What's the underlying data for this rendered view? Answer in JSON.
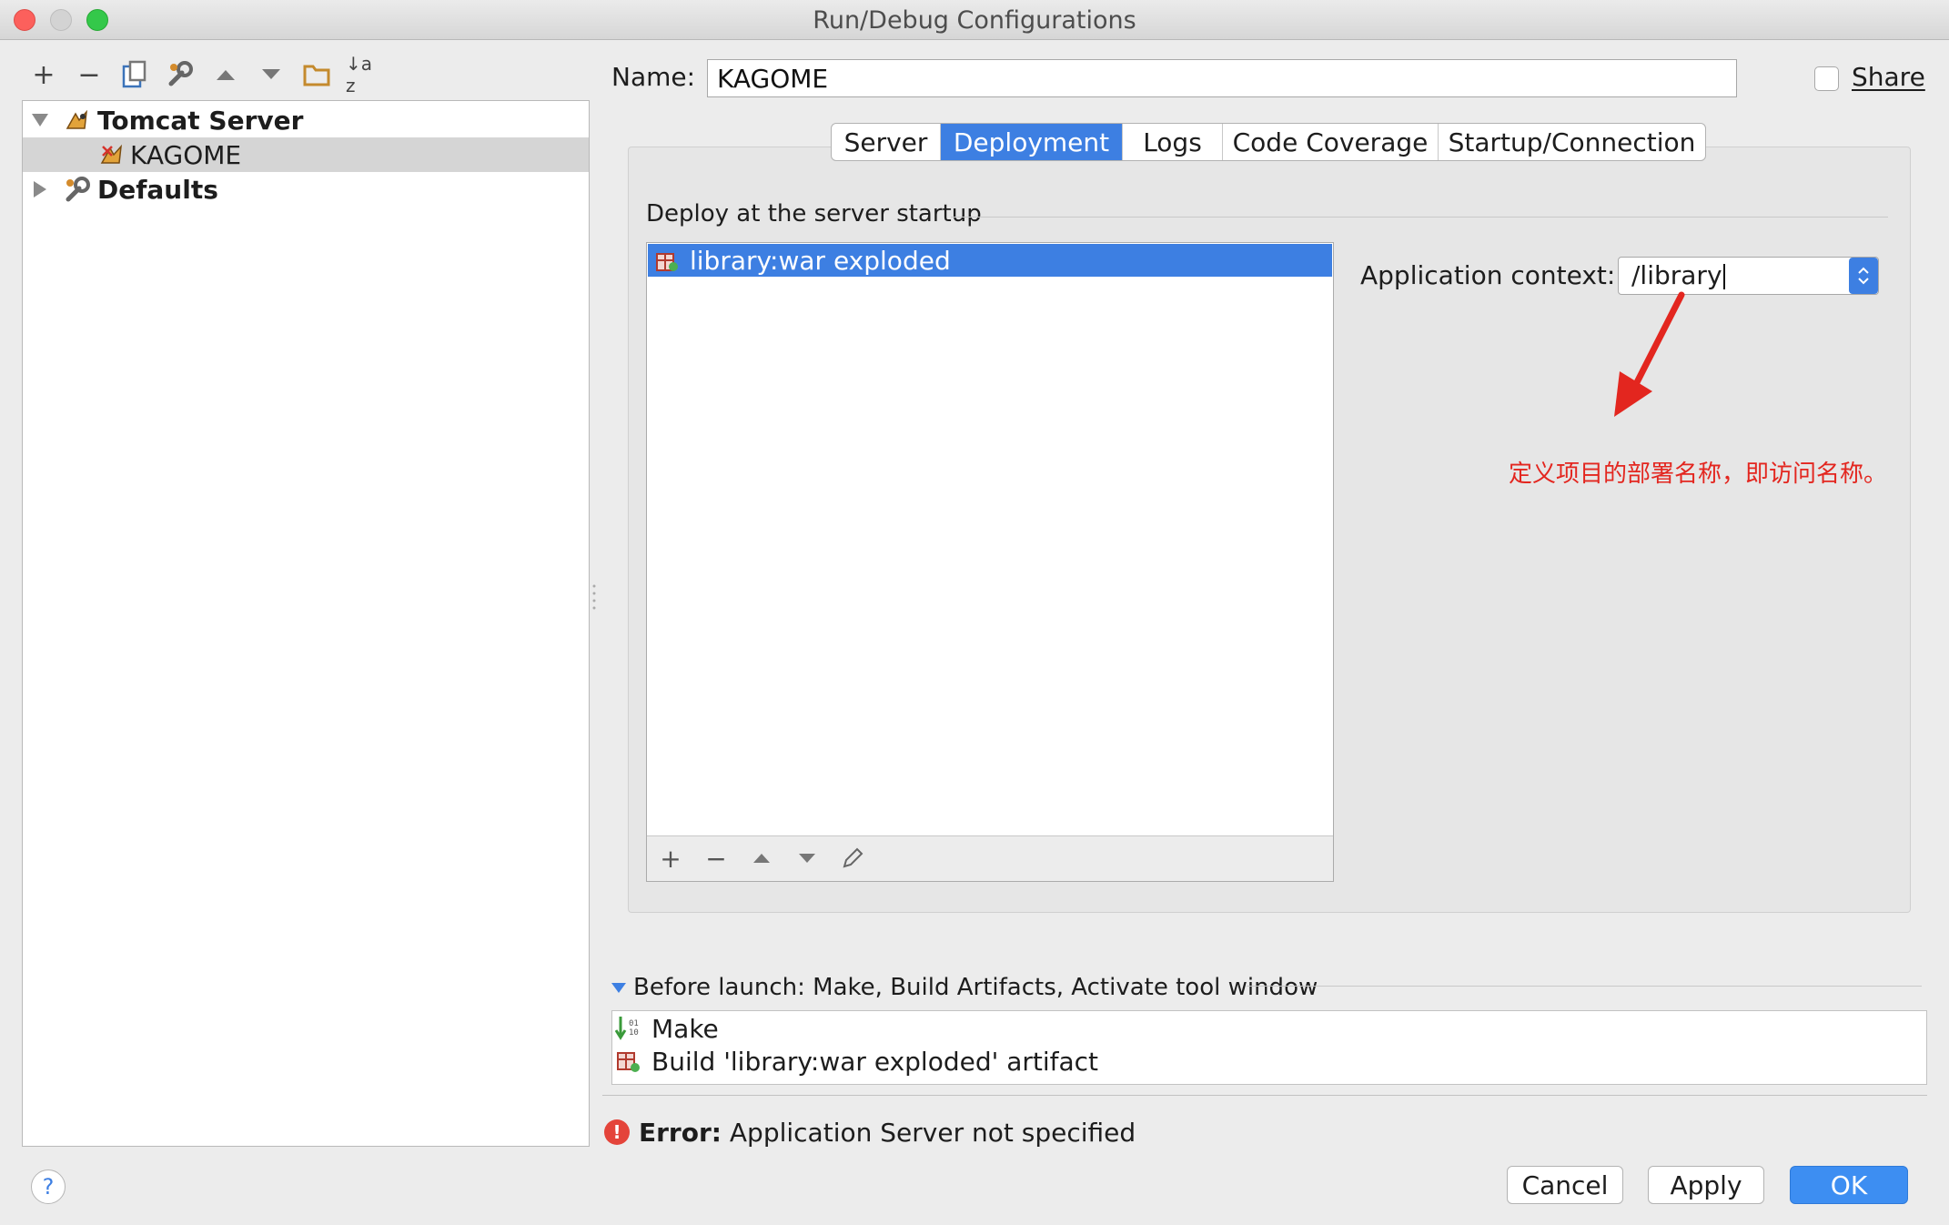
{
  "window": {
    "title": "Run/Debug Configurations"
  },
  "toolbar": {
    "icons": [
      "add-icon",
      "remove-icon",
      "copy-icon",
      "wrench-icon",
      "move-up-icon",
      "move-down-icon",
      "folder-icon",
      "sort-icon"
    ],
    "add": "+",
    "remove": "−",
    "sort": "↓a z"
  },
  "tree": {
    "items": [
      {
        "label": "Tomcat Server",
        "bold": true,
        "expanded": true
      },
      {
        "label": "KAGOME",
        "selected": true
      },
      {
        "label": "Defaults",
        "bold": true,
        "expanded": false
      }
    ]
  },
  "name": {
    "label": "Name:",
    "value": "KAGOME"
  },
  "share": {
    "label": "Share",
    "checked": false
  },
  "tabs": [
    {
      "label": "Server",
      "active": false
    },
    {
      "label": "Deployment",
      "active": true
    },
    {
      "label": "Logs",
      "active": false
    },
    {
      "label": "Code Coverage",
      "active": false
    },
    {
      "label": "Startup/Connection",
      "active": false
    }
  ],
  "deployment": {
    "group_title": "Deploy at the server startup",
    "items": [
      "library:war exploded"
    ],
    "list_toolbar": {
      "add": "+",
      "remove": "−"
    },
    "context_label": "Application context:",
    "context_value": "/library"
  },
  "annotation": {
    "text": "定义项目的部署名称，即访问名称。",
    "color": "#e3261f"
  },
  "before_launch": {
    "title": "Before launch: Make, Build Artifacts, Activate tool window",
    "items": [
      "Make",
      "Build 'library:war exploded' artifact"
    ]
  },
  "error": {
    "prefix": "Error:",
    "message": "Application Server not specified"
  },
  "buttons": {
    "help": "?",
    "cancel": "Cancel",
    "apply": "Apply",
    "ok": "OK"
  },
  "colors": {
    "accent": "#3d7fe2",
    "primary_button": "#3d8ef2",
    "error": "#e4443a"
  }
}
